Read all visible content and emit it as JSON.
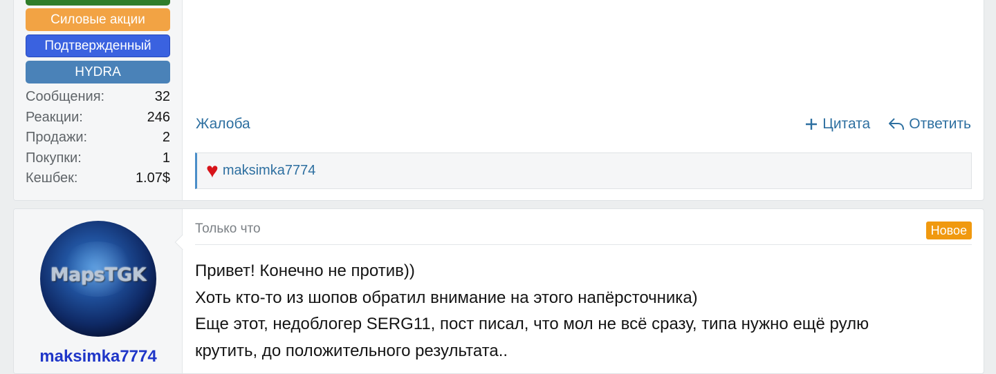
{
  "post1": {
    "banners": [
      "",
      "Силовые акции",
      "Подтвержденный",
      "HYDRA"
    ],
    "colors": {
      "green": "#2f7d2a",
      "orange": "#f2a344",
      "blue": "#3a62e0",
      "steel": "#4a82b8"
    },
    "stats": [
      {
        "key": "Сообщения:",
        "value": "32"
      },
      {
        "key": "Реакции:",
        "value": "246"
      },
      {
        "key": "Продажи:",
        "value": "2"
      },
      {
        "key": "Покупки:",
        "value": "1"
      },
      {
        "key": "Кешбек:",
        "value": "1.07$"
      }
    ],
    "report_label": "Жалоба",
    "quote_label": "Цитата",
    "reply_label": "Ответить",
    "reaction": {
      "icon": "heart-icon",
      "user": "maksimka7774"
    }
  },
  "post2": {
    "avatar_text": "MapsTGK",
    "username": "maksimka7774",
    "time": "Только что",
    "badge": "Новое",
    "lines": [
      "Привет! Конечно не против))",
      "Хоть кто-то из шопов обратил внимание на этого напёрсточника)",
      "Еще этот, недоблогер SERG11, пост писал, что мол не всё сразу, типа нужно ещё рулю",
      "крутить, до положительного результата.."
    ]
  }
}
